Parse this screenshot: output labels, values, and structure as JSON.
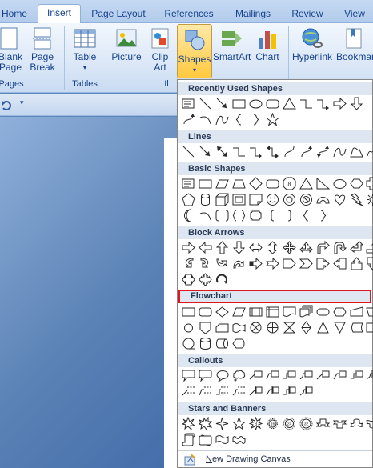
{
  "tabs": [
    {
      "label": "Home"
    },
    {
      "label": "Insert"
    },
    {
      "label": "Page Layout"
    },
    {
      "label": "References"
    },
    {
      "label": "Mailings"
    },
    {
      "label": "Review"
    },
    {
      "label": "View"
    }
  ],
  "ribbon": {
    "buttons": {
      "blank_page": [
        "Blank",
        "Page"
      ],
      "page_break": [
        "Page",
        "Break"
      ],
      "table": "Table",
      "picture": "Picture",
      "clip_art": [
        "Clip",
        "Art"
      ],
      "shapes": "Shapes",
      "smartart": "SmartArt",
      "chart": "Chart",
      "hyperlink": "Hyperlink",
      "bookmark": "Bookmar"
    },
    "groups": {
      "pages": "Pages",
      "tables": "Tables",
      "illustrations": "Il"
    }
  },
  "gallery": {
    "sections": [
      {
        "title": "Recently Used Shapes"
      },
      {
        "title": "Lines"
      },
      {
        "title": "Basic Shapes"
      },
      {
        "title": "Block Arrows"
      },
      {
        "title": "Flowchart"
      },
      {
        "title": "Callouts"
      },
      {
        "title": "Stars and Banners"
      }
    ],
    "footer_label": "New Drawing Canvas",
    "footer_accent": "N"
  },
  "colors": {
    "accent": "#15428b",
    "highlight_box": "#e0161d",
    "shape_stroke": "#2a2a2a"
  }
}
